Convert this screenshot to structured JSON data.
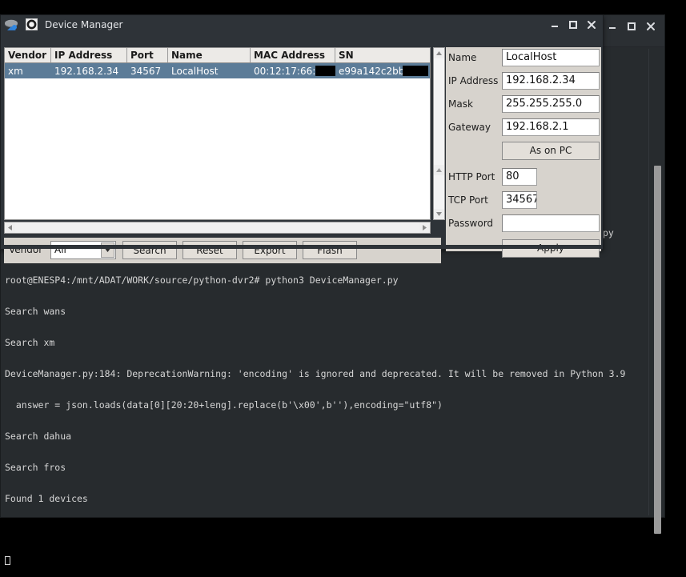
{
  "background_window": {
    "name": "terminal-window-behind",
    "controls": {
      "minimize": "minimize-icon",
      "maximize": "maximize-icon",
      "close": "close-icon"
    },
    "peek_text": "py"
  },
  "dialog": {
    "title": "Device Manager",
    "icons": {
      "app": "camera-device-icon",
      "secondary": "circle-square-icon"
    },
    "controls": {
      "minimize": "minimize-icon",
      "maximize": "maximize-icon",
      "close": "close-icon"
    },
    "table": {
      "columns": [
        "Vendor",
        "IP Address",
        "Port",
        "Name",
        "MAC Address",
        "SN"
      ],
      "rows": [
        {
          "vendor": "xm",
          "ip_address": "192.168.2.34",
          "port": "34567",
          "name": "LocalHost",
          "mac_address": "00:12:17:66:",
          "mac_redacted": true,
          "sn": "e99a142c2bba",
          "sn_redacted": true,
          "selected": true
        }
      ]
    },
    "form": {
      "fields": [
        {
          "label": "Name",
          "value": "LocalHost"
        },
        {
          "label": "IP Address",
          "value": "192.168.2.34"
        },
        {
          "label": "Mask",
          "value": "255.255.255.0"
        },
        {
          "label": "Gateway",
          "value": "192.168.2.1"
        }
      ],
      "as_on_pc_label": "As on PC",
      "http_port": {
        "label": "HTTP Port",
        "value": "80"
      },
      "tcp_port": {
        "label": "TCP Port",
        "value": "34567"
      },
      "password": {
        "label": "Password",
        "value": "",
        "placeholder": ""
      },
      "apply_label": "Apply"
    },
    "toolbar": {
      "vendor_label": "Vendor",
      "vendor_value": "All",
      "vendor_options": [
        "All"
      ],
      "buttons": [
        "Search",
        "Reset",
        "Export",
        "Flash"
      ]
    }
  },
  "terminal": {
    "lines": [
      "root@ENESP4:/mnt/ADAT/WORK/source/python-dvr2# python3 DeviceManager.py",
      "Search wans",
      "Search xm",
      "DeviceManager.py:184: DeprecationWarning: 'encoding' is ignored and deprecated. It will be removed in Python 3.9",
      "  answer = json.loads(data[0][20:20+leng].replace(b'\\x00',b''),encoding=\"utf8\")",
      "Search dahua",
      "Search fros",
      "Found 1 devices",
      ""
    ]
  },
  "colors": {
    "desktop": "#000000",
    "window_chrome": "#2e3338",
    "terminal_bg": "#272b2e",
    "selection": "#5c7c98",
    "panel": "#d7d3cd",
    "redaction": "#000000"
  }
}
